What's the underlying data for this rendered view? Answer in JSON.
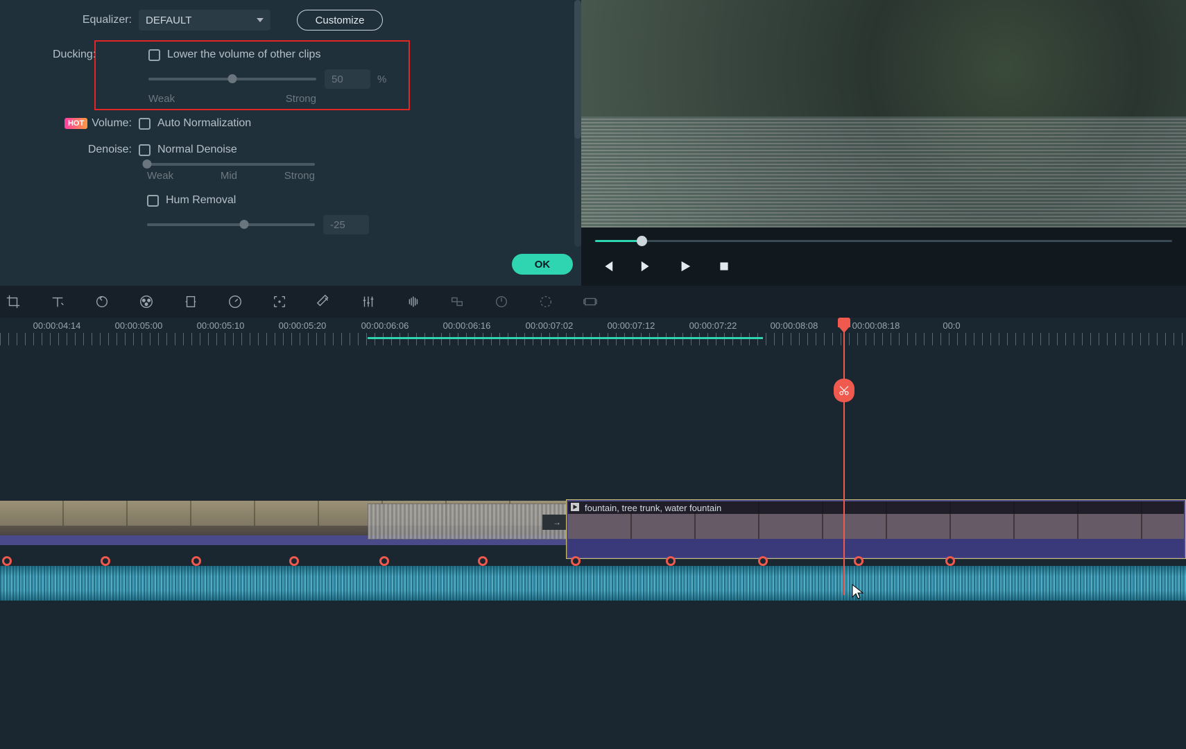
{
  "settings": {
    "equalizer": {
      "label": "Equalizer:",
      "value": "DEFAULT",
      "customize": "Customize"
    },
    "ducking": {
      "label": "Ducking:",
      "checkbox_label": "Lower the volume of other clips",
      "value": "50",
      "unit": "%",
      "legend_left": "Weak",
      "legend_right": "Strong"
    },
    "volume": {
      "hot": "HOT",
      "label": "Volume:",
      "checkbox_label": "Auto Normalization"
    },
    "denoise": {
      "label": "Denoise:",
      "checkbox_label": "Normal Denoise",
      "legend_left": "Weak",
      "legend_mid": "Mid",
      "legend_right": "Strong"
    },
    "hum": {
      "checkbox_label": "Hum Removal",
      "value": "-25"
    },
    "ok": "OK"
  },
  "ruler": {
    "tc0": "00:00:04:14",
    "tc1": "00:00:05:00",
    "tc2": "00:00:05:10",
    "tc3": "00:00:05:20",
    "tc4": "00:00:06:06",
    "tc5": "00:00:06:16",
    "tc6": "00:00:07:02",
    "tc7": "00:00:07:12",
    "tc8": "00:00:07:22",
    "tc9": "00:00:08:08",
    "tc10": "00:00:08:18",
    "tc11": "00:0"
  },
  "clip2": {
    "label": "fountain, tree trunk, water fountain"
  },
  "transition_handle": "→",
  "keyframe_positions": [
    10,
    152,
    283,
    424,
    554,
    696,
    830,
    967,
    1100,
    1238,
    1370
  ],
  "toolbar_icons": [
    "crop",
    "text",
    "rotate",
    "color",
    "stabilize",
    "speed",
    "focus",
    "paint",
    "adjust-sliders",
    "waveform",
    "split-audio",
    "audio-dial",
    "sync",
    "frame"
  ]
}
